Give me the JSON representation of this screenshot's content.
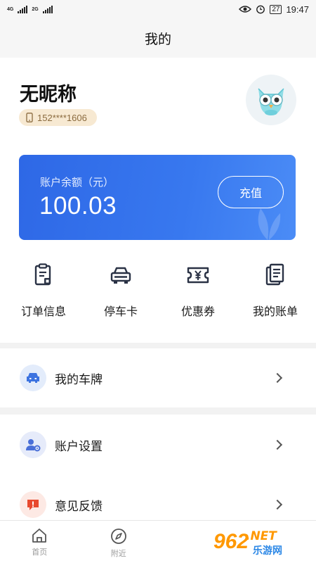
{
  "status_bar": {
    "net1": "4G",
    "net2": "2G",
    "battery": "27",
    "time": "19:47"
  },
  "header": {
    "title": "我的"
  },
  "profile": {
    "nickname": "无昵称",
    "phone": "152****1606"
  },
  "balance": {
    "label": "账户余额（元）",
    "amount": "100.03",
    "recharge_label": "充值"
  },
  "quick_menu": [
    {
      "label": "订单信息",
      "icon": "clipboard-icon"
    },
    {
      "label": "停车卡",
      "icon": "car-icon"
    },
    {
      "label": "优惠券",
      "icon": "coupon-icon"
    },
    {
      "label": "我的账单",
      "icon": "bill-icon"
    }
  ],
  "list": {
    "plate": "我的车牌",
    "account_settings": "账户设置",
    "feedback": "意见反馈"
  },
  "tabs": [
    {
      "label": "首页",
      "icon": "home-icon"
    },
    {
      "label": "附近",
      "icon": "compass-icon"
    }
  ],
  "watermark": {
    "number": "962",
    "net": ".NET",
    "text": "乐游网"
  },
  "colors": {
    "accent_blue": "#2e68e6",
    "badge_bg": "#f7e9d2",
    "feedback_red": "#e8492e"
  }
}
